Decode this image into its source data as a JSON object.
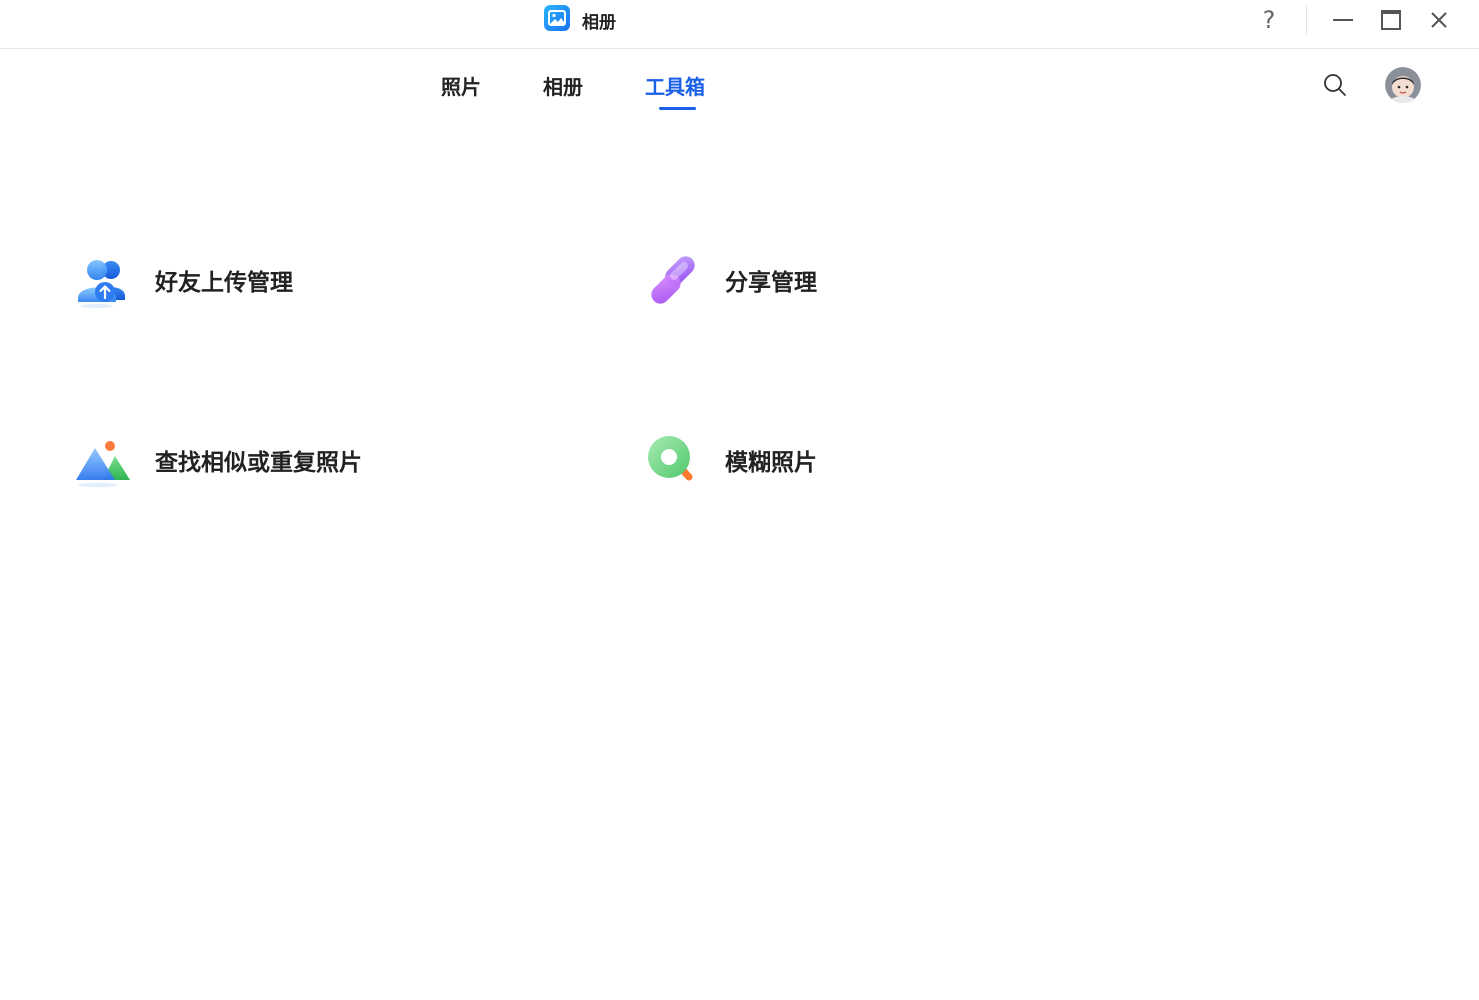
{
  "titlebar": {
    "app_title": "相册",
    "help_symbol": "?"
  },
  "icons": {
    "app_icon": "photo-icon",
    "help": "help-icon",
    "minimize": "minimize-icon",
    "maximize": "maximize-icon",
    "close": "close-icon",
    "search": "search-icon",
    "avatar": "avatar"
  },
  "nav": {
    "tabs": [
      {
        "label": "照片",
        "active": false
      },
      {
        "label": "相册",
        "active": false
      },
      {
        "label": "工具箱",
        "active": true
      }
    ]
  },
  "tools": [
    {
      "label": "好友上传管理",
      "icon": "friend-upload-icon"
    },
    {
      "label": "分享管理",
      "icon": "link-icon"
    },
    {
      "label": "查找相似或重复照片",
      "icon": "mountain-photo-icon"
    },
    {
      "label": "模糊照片",
      "icon": "blur-magnifier-icon"
    }
  ],
  "colors": {
    "accent": "#1a5fe8",
    "text": "#222222",
    "background": "#ffffff"
  }
}
